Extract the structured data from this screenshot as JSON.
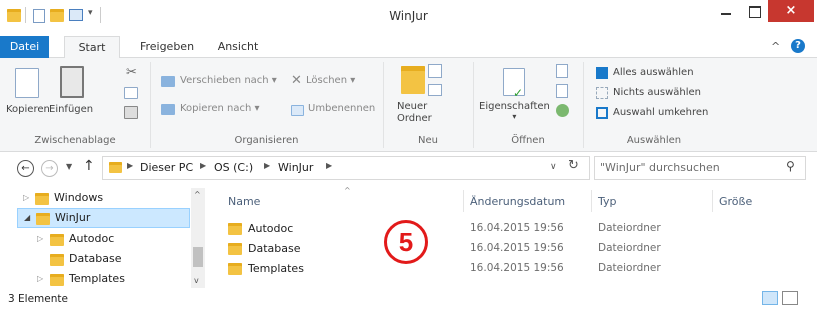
{
  "window": {
    "title": "WinJur",
    "close_glyph": "×"
  },
  "quick_access": {
    "icons": [
      "folder-icon",
      "properties-icon",
      "new-folder-icon",
      "customize-dropdown-icon"
    ]
  },
  "ribbon_tabs": {
    "file": "Datei",
    "items": [
      "Start",
      "Freigeben",
      "Ansicht"
    ],
    "active": "Start"
  },
  "ribbon": {
    "clipboard": {
      "copy": "Kopieren",
      "paste": "Einfügen",
      "group": "Zwischenablage"
    },
    "organize": {
      "move": "Verschieben nach",
      "copy_to": "Kopieren nach",
      "delete": "Löschen",
      "rename": "Umbenennen",
      "group": "Organisieren"
    },
    "new": {
      "new_folder_line1": "Neuer",
      "new_folder_line2": "Ordner",
      "group": "Neu"
    },
    "open": {
      "properties": "Eigenschaften",
      "group": "Öffnen"
    },
    "select": {
      "select_all": "Alles auswählen",
      "select_none": "Nichts auswählen",
      "invert": "Auswahl umkehren",
      "group": "Auswählen"
    }
  },
  "address": {
    "crumbs": [
      "Dieser PC",
      "OS (C:)",
      "WinJur"
    ],
    "search_placeholder": "\"WinJur\" durchsuchen"
  },
  "nav_tree": [
    {
      "label": "Windows",
      "expanded": false,
      "selected": false
    },
    {
      "label": "WinJur",
      "expanded": true,
      "selected": true
    },
    {
      "label": "Autodoc",
      "expanded": false,
      "selected": false
    },
    {
      "label": "Database",
      "expanded": false,
      "selected": false
    },
    {
      "label": "Templates",
      "expanded": false,
      "selected": false
    }
  ],
  "columns": {
    "name": "Name",
    "date": "Änderungsdatum",
    "type": "Typ",
    "size": "Größe"
  },
  "files": [
    {
      "name": "Autodoc",
      "date": "16.04.2015 19:56",
      "type": "Dateiordner"
    },
    {
      "name": "Database",
      "date": "16.04.2015 19:56",
      "type": "Dateiordner"
    },
    {
      "name": "Templates",
      "date": "16.04.2015 19:56",
      "type": "Dateiordner"
    }
  ],
  "status": {
    "count": "3 Elemente"
  },
  "annotation": {
    "step": "5",
    "color": "#e21a1a"
  },
  "colors": {
    "accent": "#1979ca",
    "folder": "#f3c343",
    "selection": "#cce8ff",
    "close": "#c7372f"
  }
}
